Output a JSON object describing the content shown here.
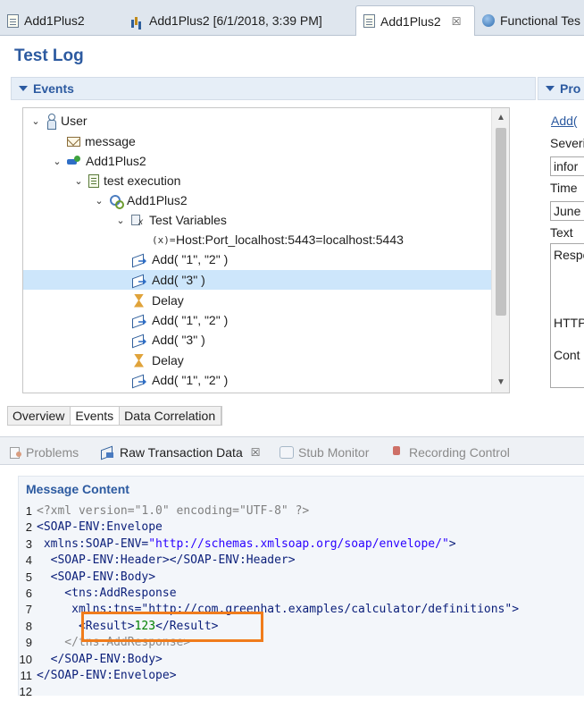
{
  "editor_tabs": [
    {
      "label": "Add1Plus2",
      "icon": "file-icon"
    },
    {
      "label": "Add1Plus2 [6/1/2018, 3:39 PM]",
      "icon": "report-icon"
    },
    {
      "label": "Add1Plus2",
      "icon": "file-icon",
      "active": true,
      "close": "☒"
    },
    {
      "label": "Functional Tes",
      "icon": "globe-icon"
    }
  ],
  "page_title": "Test Log",
  "events_section": {
    "label": "Events"
  },
  "properties_section": {
    "label": "Pro"
  },
  "tree": [
    {
      "chevron": "⌄",
      "icon": "user-icon",
      "label": "User"
    },
    {
      "chevron": "",
      "icon": "message-icon",
      "label": "message"
    },
    {
      "chevron": "⌄",
      "icon": "operation-icon",
      "label": "Add1Plus2"
    },
    {
      "chevron": "⌄",
      "icon": "document-icon",
      "label": "test execution"
    },
    {
      "chevron": "⌄",
      "icon": "gears-icon",
      "label": "Add1Plus2"
    },
    {
      "chevron": "⌄",
      "icon": "variables-icon",
      "label": "Test Variables"
    },
    {
      "chevron": "",
      "icon": "x-icon",
      "prefix": "(x)=",
      "label": "Host:Port_localhost:5443=localhost:5443"
    },
    {
      "chevron": "",
      "icon": "message-send-icon",
      "label": "Add( \"1\", \"2\" )"
    },
    {
      "chevron": "",
      "icon": "message-send-icon",
      "label": "Add( \"3\" )",
      "selected": true
    },
    {
      "chevron": "",
      "icon": "hourglass-icon",
      "label": "Delay"
    },
    {
      "chevron": "",
      "icon": "message-send-icon",
      "label": "Add( \"1\", \"2\" )"
    },
    {
      "chevron": "",
      "icon": "message-send-icon",
      "label": "Add( \"3\" )"
    },
    {
      "chevron": "",
      "icon": "hourglass-icon",
      "label": "Delay"
    },
    {
      "chevron": "",
      "icon": "message-send-icon",
      "label": "Add( \"1\", \"2\" )"
    }
  ],
  "properties": {
    "link": "Add(",
    "severity_label": "Severi",
    "severity_value": "infor",
    "time_label": "Time",
    "time_value": "June",
    "text_label": "Text",
    "text_lines": [
      "Respo",
      "HTTP",
      "Cont"
    ]
  },
  "sub_tabs": [
    "Overview",
    "Events",
    "Data Correlation"
  ],
  "active_sub_tab": "Events",
  "views": [
    {
      "label": "Problems",
      "icon": "problems-icon"
    },
    {
      "label": "Raw Transaction Data",
      "icon": "raw-transaction-icon",
      "active": true,
      "close": "☒"
    },
    {
      "label": "Stub Monitor",
      "icon": "stub-monitor-icon"
    },
    {
      "label": "Recording Control",
      "icon": "recording-control-icon"
    }
  ],
  "message_content": {
    "title": "Message Content",
    "lines": [
      {
        "n": "1",
        "parts": [
          {
            "t": "<?xml version=\"1.0\" encoding=\"UTF-8\" ?>",
            "c": "pi"
          }
        ]
      },
      {
        "n": "2",
        "parts": [
          {
            "t": "<SOAP-ENV:Envelope",
            "c": "tag"
          }
        ]
      },
      {
        "n": "3",
        "parts": [
          {
            "t": " xmlns:SOAP-ENV=",
            "c": "ns"
          },
          {
            "t": "\"http://schemas.xmlsoap.org/soap/envelope/\"",
            "c": "attrval"
          },
          {
            "t": ">",
            "c": "tag"
          }
        ]
      },
      {
        "n": "4",
        "parts": [
          {
            "t": "  <SOAP-ENV:Header></SOAP-ENV:Header>",
            "c": "tag"
          }
        ]
      },
      {
        "n": "5",
        "parts": [
          {
            "t": "  <SOAP-ENV:Body>",
            "c": "tag"
          }
        ]
      },
      {
        "n": "6",
        "parts": [
          {
            "t": "    <tns:AddResponse",
            "c": "tag"
          }
        ]
      },
      {
        "n": "7",
        "parts": [
          {
            "t": "     xmlns:tns=\"http://com.greenhat.examples/calculator/definitions\">",
            "c": "tag"
          }
        ]
      },
      {
        "n": "8",
        "parts": [
          {
            "t": "      <Result>",
            "c": "tag"
          },
          {
            "t": "123",
            "c": "val"
          },
          {
            "t": "</Result>",
            "c": "tag"
          }
        ]
      },
      {
        "n": "9",
        "parts": [
          {
            "t": "    </tns:AddResponse>",
            "c": "grey"
          }
        ]
      },
      {
        "n": "10",
        "parts": [
          {
            "t": "  </SOAP-ENV:Body>",
            "c": "tag"
          }
        ]
      },
      {
        "n": "11",
        "parts": [
          {
            "t": "</SOAP-ENV:Envelope>",
            "c": "tag"
          }
        ]
      },
      {
        "n": "12",
        "parts": []
      }
    ]
  },
  "colors": {
    "accent": "#2c5aa0",
    "selection": "#cde6fb",
    "highlight_border": "#f07c1c"
  }
}
